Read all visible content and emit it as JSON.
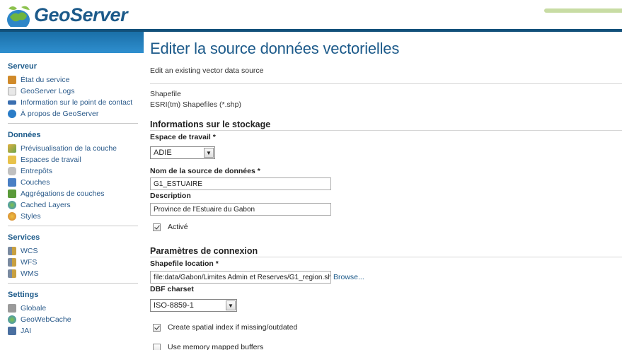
{
  "header": {
    "logo_text": "GeoServer"
  },
  "sidebar": {
    "sections": [
      {
        "title": "Serveur",
        "items": [
          {
            "label": "État du service",
            "icon": "server-status-icon",
            "color": "#d08a2a"
          },
          {
            "label": "GeoServer Logs",
            "icon": "logs-icon",
            "color": "#cfcfcf"
          },
          {
            "label": "Information sur le point de contact",
            "icon": "contact-info-icon",
            "color": "#3b6fb0"
          },
          {
            "label": "À propos de GeoServer",
            "icon": "about-icon",
            "color": "#2a7cc7"
          }
        ]
      },
      {
        "title": "Données",
        "items": [
          {
            "label": "Prévisualisation de la couche",
            "icon": "layer-preview-icon",
            "color": "#6ba44a"
          },
          {
            "label": "Espaces de travail",
            "icon": "workspaces-icon",
            "color": "#e8c24a"
          },
          {
            "label": "Entrepôts",
            "icon": "stores-icon",
            "color": "#b8b8b8"
          },
          {
            "label": "Couches",
            "icon": "layers-icon",
            "color": "#4a7fc4"
          },
          {
            "label": "Aggrégations de couches",
            "icon": "layer-groups-icon",
            "color": "#5a9a3a"
          },
          {
            "label": "Cached Layers",
            "icon": "cached-layers-icon",
            "color": "#3a8ad0"
          },
          {
            "label": "Styles",
            "icon": "styles-icon",
            "color": "#e0a030"
          }
        ]
      },
      {
        "title": "Services",
        "items": [
          {
            "label": "WCS",
            "icon": "wcs-icon",
            "color": "#7a8aa0"
          },
          {
            "label": "WFS",
            "icon": "wfs-icon",
            "color": "#7a8aa0"
          },
          {
            "label": "WMS",
            "icon": "wms-icon",
            "color": "#7a8aa0"
          }
        ]
      },
      {
        "title": "Settings",
        "items": [
          {
            "label": "Globale",
            "icon": "global-settings-icon",
            "color": "#9a9a9a"
          },
          {
            "label": "GeoWebCache",
            "icon": "geowebcache-icon",
            "color": "#3a8ad0"
          },
          {
            "label": "JAI",
            "icon": "jai-icon",
            "color": "#4a6fa0"
          }
        ]
      }
    ]
  },
  "main": {
    "title": "Editer la source données vectorielles",
    "description": "Edit an existing vector data source",
    "type_label": "Shapefile",
    "type_desc": "ESRI(tm) Shapefiles (*.shp)",
    "storage_section": "Informations sur le stockage",
    "workspace_label": "Espace de travail *",
    "workspace_value": "ADIE",
    "datasource_label": "Nom de la source de données *",
    "datasource_value": "G1_ESTUAIRE",
    "description_label": "Description",
    "description_value": "Province de l'Estuaire du Gabon",
    "enabled_label": "Activé",
    "connection_section": "Paramètres de connexion",
    "shapefile_location_label": "Shapefile location *",
    "shapefile_location_value": "file:data/Gabon/Limites Admin et Reserves/G1_region.sh",
    "browse_label": "Browse...",
    "dbf_charset_label": "DBF charset",
    "dbf_charset_value": "ISO-8859-1",
    "spatial_index_label": "Create spatial index if missing/outdated",
    "memory_mapped_label": "Use memory mapped buffers"
  },
  "colors": {
    "brand_blue": "#1c5a8a",
    "bar_blue": "#12507a",
    "accent_green": "#c8dca4"
  }
}
